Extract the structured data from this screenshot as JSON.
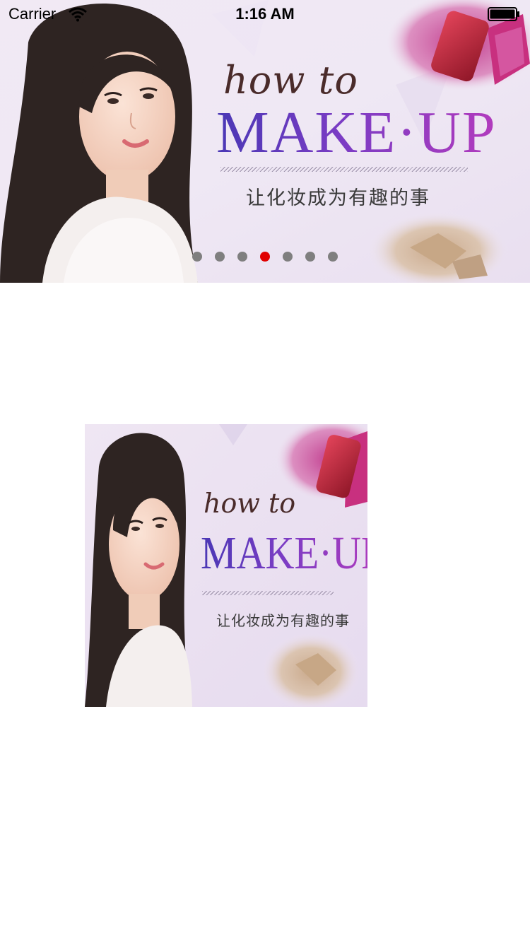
{
  "status_bar": {
    "carrier": "Carrier",
    "time": "1:16 AM"
  },
  "banner": {
    "heading_small": "how to",
    "heading_large": "MAKE·UP",
    "subtitle": "让化妆成为有趣的事",
    "page_indicator": {
      "count": 7,
      "active_index": 3,
      "active_color": "#e00000",
      "inactive_color": "#7f7f7f"
    }
  },
  "thumbnail": {
    "heading_small": "how to",
    "heading_large": "MAKE·UP",
    "subtitle": "让化妆成为有趣的事"
  }
}
